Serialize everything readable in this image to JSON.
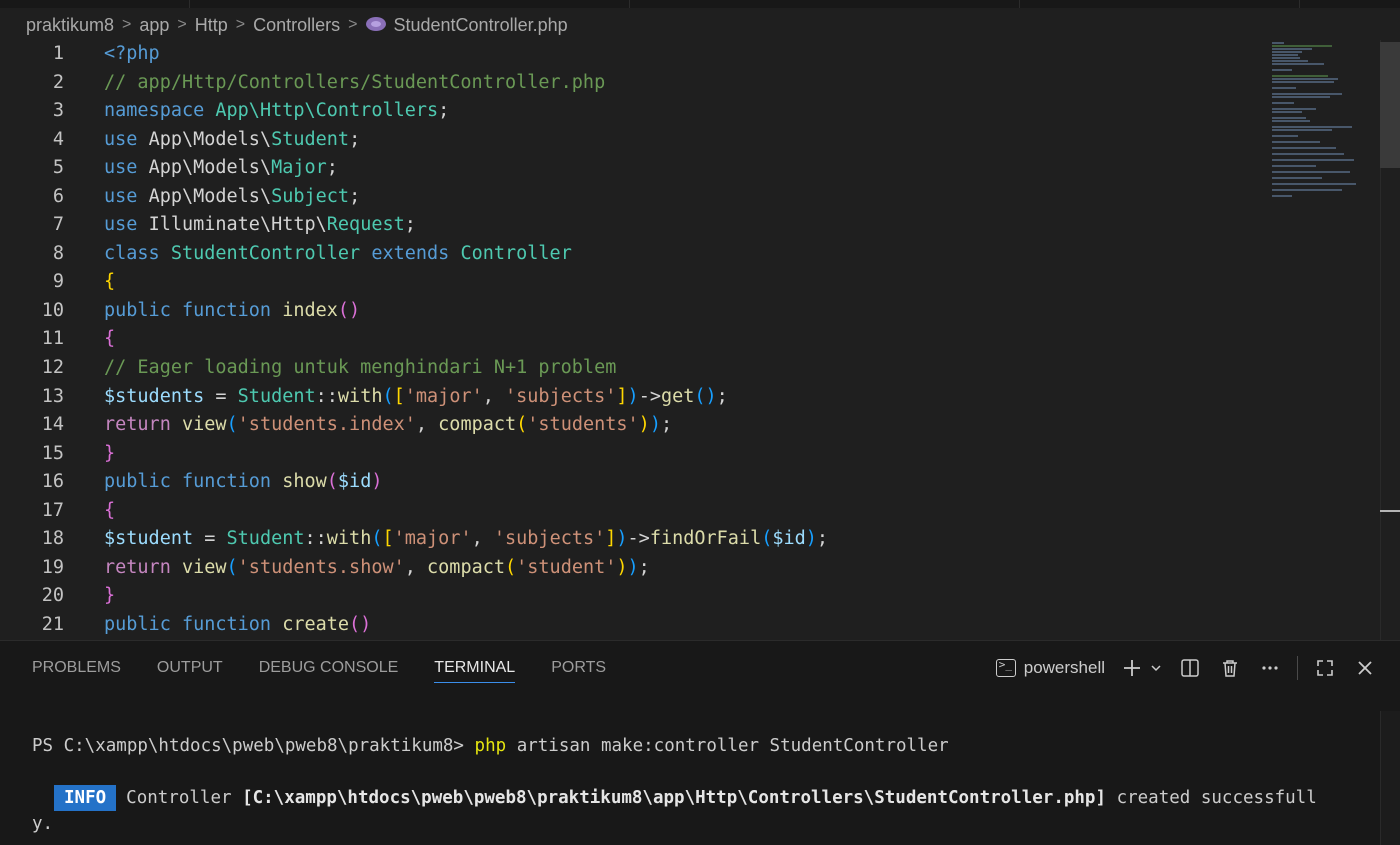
{
  "breadcrumb": {
    "items": [
      "praktikum8",
      "app",
      "Http",
      "Controllers"
    ],
    "file": "StudentController.php",
    "separator": ">"
  },
  "editor": {
    "line_numbers": [
      "1",
      "2",
      "3",
      "4",
      "5",
      "6",
      "7",
      "8",
      "9",
      "10",
      "11",
      "12",
      "13",
      "14",
      "15",
      "16",
      "17",
      "18",
      "19",
      "20",
      "21"
    ]
  },
  "code": {
    "l1": "<?php",
    "l2": "// app/Http/Controllers/StudentController.php",
    "l3_kw": "namespace",
    "l3_ns": "App\\Http\\Controllers",
    "l4_a": "App\\Models\\",
    "l4_b": "Student",
    "l5_a": "App\\Models\\",
    "l5_b": "Major",
    "l6_a": "App\\Models\\",
    "l6_b": "Subject",
    "l7_a": "Illuminate\\Http\\",
    "l7_b": "Request",
    "use": "use",
    "class_kw": "class",
    "class_name": "StudentController",
    "extends_kw": "extends",
    "parent": "Controller",
    "public": "public",
    "function": "function",
    "return": "return",
    "fn_index": "index",
    "fn_show": "show",
    "fn_create": "create",
    "comment12": "// Eager loading untuk menghindari N+1 problem",
    "var_students": "$students",
    "var_student": "$student",
    "var_id": "$id",
    "cls_student": "Student",
    "with": "with",
    "str_major": "'major'",
    "str_subjects": "'subjects'",
    "get": "get",
    "findOrFail": "findOrFail",
    "view": "view",
    "compact": "compact",
    "str_students_index": "'students.index'",
    "str_students": "'students'",
    "str_students_show": "'students.show'",
    "str_student": "'student'"
  },
  "panel": {
    "tabs": [
      "PROBLEMS",
      "OUTPUT",
      "DEBUG CONSOLE",
      "TERMINAL",
      "PORTS"
    ],
    "active_tab": "TERMINAL",
    "terminal_name": "powershell",
    "icons": [
      "terminal-icon",
      "plus-icon",
      "chevron-down-icon",
      "split-icon",
      "trash-icon",
      "more-icon",
      "maximize-icon",
      "close-icon"
    ]
  },
  "terminal": {
    "prompt": "PS C:\\xampp\\htdocs\\pweb\\pweb8\\praktikum8>",
    "cmd": "php",
    "args": "artisan make:controller StudentController",
    "badge": "INFO",
    "msg_a": "Controller",
    "msg_path": "[C:\\xampp\\htdocs\\pweb\\pweb8\\praktikum8\\app\\Http\\Controllers\\StudentController.php]",
    "msg_b": "created successfull",
    "msg_c": "y."
  },
  "colors": {
    "background": "#1f1f1f",
    "keyword": "#569cd6",
    "type": "#4ec9b0",
    "function": "#dcdcaa",
    "string": "#ce9178",
    "comment": "#6a9955",
    "variable": "#9cdcfe",
    "info_badge": "#2472c8",
    "command": "#e5e510"
  }
}
